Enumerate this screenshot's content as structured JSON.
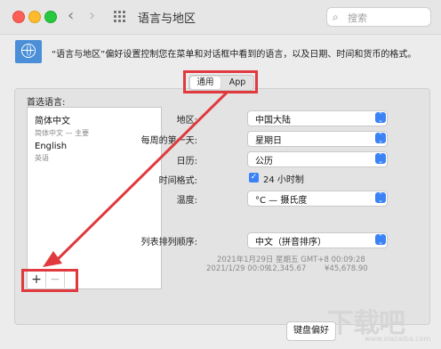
{
  "window": {
    "title": "语言与地区",
    "search_placeholder": "搜索",
    "description": "“语言与地区”偏好设置控制您在菜单和对话框中看到的语言，以及日期、时间和货币的格式。"
  },
  "tabs": [
    {
      "label": "通用",
      "selected": true
    },
    {
      "label": "App",
      "selected": false
    }
  ],
  "preferred_languages": {
    "label": "首选语言:",
    "items": [
      {
        "name": "简体中文",
        "sub": "简体中文 — 主要"
      },
      {
        "name": "English",
        "sub": "英语"
      }
    ],
    "add_label": "+",
    "remove_label": "−"
  },
  "settings": {
    "region": {
      "label": "地区:",
      "value": "中国大陆"
    },
    "first_day": {
      "label": "每周的第一天:",
      "value": "星期日"
    },
    "calendar": {
      "label": "日历:",
      "value": "公历"
    },
    "time_format": {
      "label": "时间格式:",
      "checkbox_label": "24 小时制",
      "checked": true
    },
    "temperature": {
      "label": "温度:",
      "value": "°C — 摄氏度"
    },
    "list_sort": {
      "label": "列表排列顺序:",
      "value": "中文（拼音排序）"
    }
  },
  "samples": {
    "line1": "2021年1月29日 星期五 GMT+8 00:09:28",
    "line2_date": "2021/1/29 00:09",
    "line2_number": "12,345.67",
    "line2_currency": "¥45,678.90"
  },
  "buttons": {
    "keyboard_prefs": "键盘偏好"
  },
  "watermark": {
    "main": "下载吧",
    "sub": "www.xiazaiba.com"
  },
  "colors": {
    "highlight": "#e0393e",
    "accent": "#3b82f7",
    "globe": "#4a8fd8"
  }
}
